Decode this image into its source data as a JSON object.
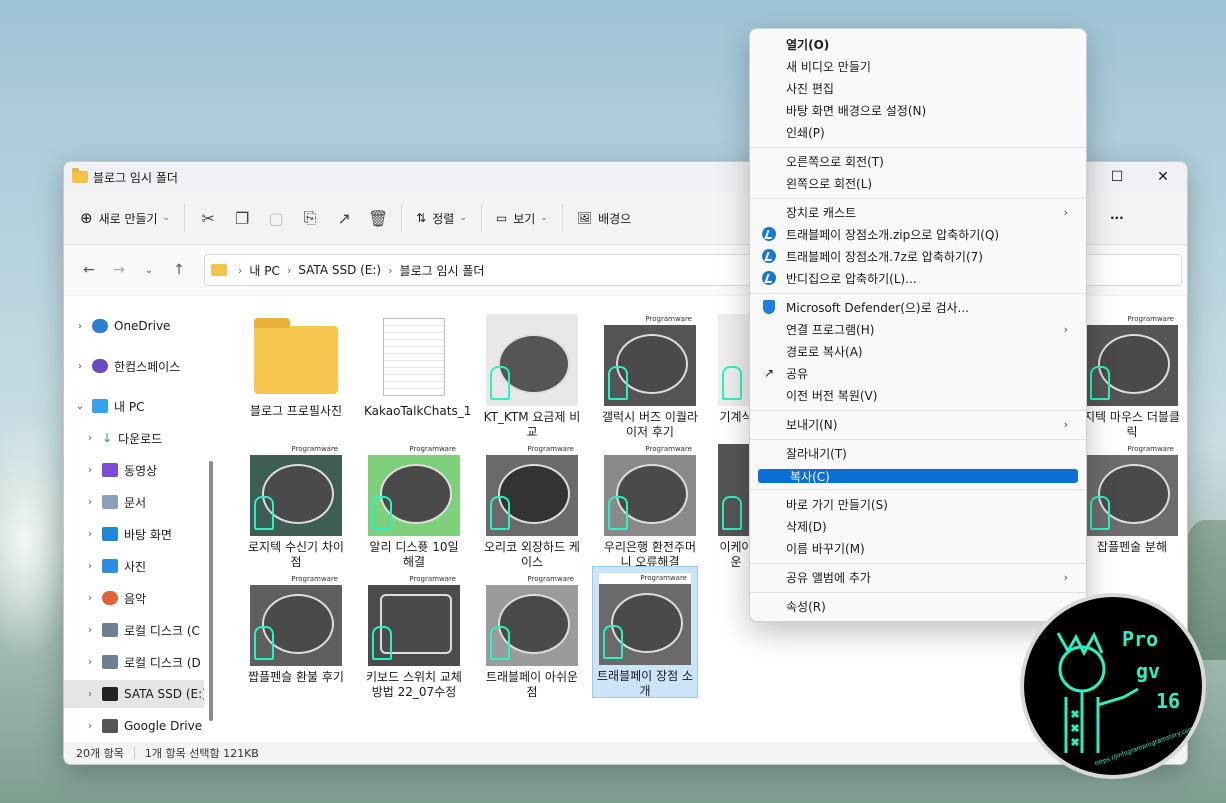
{
  "window": {
    "title": "블로그 임시 폴더"
  },
  "toolbar": {
    "new_label": "새로 만들기",
    "sort_label": "정렬",
    "view_label": "보기",
    "bg_label": "배경으",
    "more_label": "···"
  },
  "address": {
    "crumbs": [
      "내 PC",
      "SATA SSD (E:)",
      "블로그 임시 폴더"
    ]
  },
  "sidebar": {
    "items": [
      {
        "label": "OneDrive"
      },
      {
        "label": "한컴스페이스"
      },
      {
        "label": "내 PC"
      },
      {
        "label": "다운로드"
      },
      {
        "label": "동영상"
      },
      {
        "label": "문서"
      },
      {
        "label": "바탕 화면"
      },
      {
        "label": "사진"
      },
      {
        "label": "음악"
      },
      {
        "label": "로컬 디스크 (C"
      },
      {
        "label": "로컬 디스크 (D"
      },
      {
        "label": "SATA SSD (E:)"
      },
      {
        "label": "Google Drive ("
      }
    ]
  },
  "files": [
    {
      "label": "블로그 프로필사진"
    },
    {
      "label": "KakaoTalkChats_1"
    },
    {
      "label": "KT_KTM 요금제 비교"
    },
    {
      "label": "갤럭시 버즈 이퀄라이저 후기"
    },
    {
      "label": "기계식"
    },
    {
      "label": "지텍 마우스 더블클릭"
    },
    {
      "label": "로지텍 수신기 차이점"
    },
    {
      "label": "알리 디스퓻 10일 해결"
    },
    {
      "label": "오리코 외장하드 케이스"
    },
    {
      "label": "우리은행 환전주머니 오류해결"
    },
    {
      "label": "이케아 운"
    },
    {
      "label": "잡플펜술 분해"
    },
    {
      "label": "짭플펜슬 환불 후기"
    },
    {
      "label": "키보드 스위치 교체방법 22_07수정"
    },
    {
      "label": "트래블페이 아쉬운 점"
    },
    {
      "label": "트래블페이 장점 소개"
    }
  ],
  "thumb_header": "Programware",
  "status": {
    "count": "20개 항목",
    "selection": "1개 항목 선택함 121KB"
  },
  "menu": {
    "open": "열기(O)",
    "new_video": "새 비디오 만들기",
    "edit_photo": "사진 편집",
    "set_bg": "바탕 화면 배경으로 설정(N)",
    "print": "인쇄(P)",
    "rotate_right": "오른쪽으로 회전(T)",
    "rotate_left": "왼쪽으로 회전(L)",
    "cast": "장치로 캐스트",
    "zip": "트래블페이 장점소개.zip으로 압축하기(Q)",
    "sevenz": "트래블페이 장점소개.7z로 압축하기(7)",
    "bandizip": "반디집으로 압축하기(L)...",
    "defender": "Microsoft Defender(으)로 검사...",
    "open_with": "연결 프로그램(H)",
    "copy_path": "경로로 복사(A)",
    "share": "공유",
    "restore": "이전 버전 복원(V)",
    "send_to": "보내기(N)",
    "cut": "잘라내기(T)",
    "copy": "복사(C)",
    "shortcut": "바로 가기 만들기(S)",
    "delete": "삭제(D)",
    "rename": "이름 바꾸기(M)",
    "add_album": "공유 앨범에 추가",
    "properties": "속성(R)"
  },
  "logo": {
    "line1": "Pro",
    "line2": "gv",
    "line3": "16",
    "url": "https://jinfogramprogramstory.com"
  }
}
